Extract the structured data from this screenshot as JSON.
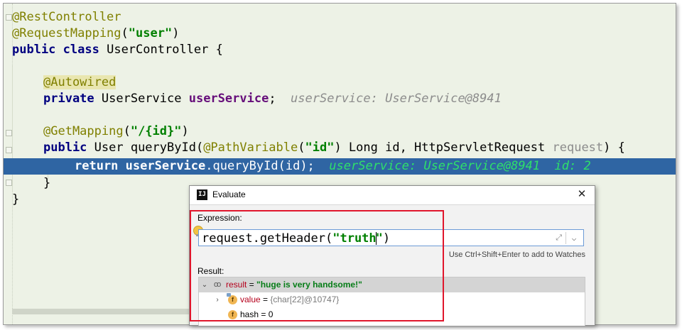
{
  "code": {
    "line1": "@RestController",
    "line2_ann": "@RequestMapping",
    "line2_open": "(",
    "line2_str": "\"user\"",
    "line2_close": ")",
    "line3_kw1": "public",
    "line3_kw2": "class",
    "line3_rest": " UserController {",
    "line5_ann": "@Autowired",
    "line6_kw": "private",
    "line6_type": " UserService ",
    "line6_field": "userService",
    "line6_semi": ";",
    "line6_hint": "userService: UserService@8941",
    "line8_ann": "@GetMapping",
    "line8_open": "(",
    "line8_str": "\"/{id}\"",
    "line8_close": ")",
    "line9_kw": "public",
    "line9_a": " User queryById(",
    "line9_ann": "@PathVariable",
    "line9_b": "(",
    "line9_str": "\"id\"",
    "line9_c": ") Long id, HttpServletRequest ",
    "line9_param": "request",
    "line9_d": ") {",
    "line10_kw": "return",
    "line10_field": "userService",
    "line10_rest": ".queryById(id);",
    "line10_hint": "userService: UserService@8941  id: 2",
    "line11": "}",
    "line12": "}"
  },
  "dialog": {
    "title": "Evaluate",
    "close_glyph": "✕",
    "expression_label": "Expression:",
    "expression_a": "request.getHeader(",
    "expression_str_a": "\"truth",
    "expression_str_b": "\"",
    "expression_b": ")",
    "expand_glyph": "⤢",
    "dropdown_glyph": "⌵",
    "watch_hint": "Use Ctrl+Shift+Enter to add to Watches",
    "result_label": "Result:",
    "tree": {
      "row1_twisty": "⌄",
      "row1_glasses": "oo",
      "row1_name": "result",
      "row1_eq": " = ",
      "row1_value": "\"huge is very handsome!\"",
      "row2_twisty": "›",
      "row2_icon": "f",
      "row2_name": "value",
      "row2_eq": " = ",
      "row2_value": "{char[22]@10747}",
      "row3_icon": "f",
      "row3_name": "hash",
      "row3_eq": " = ",
      "row3_value": "0"
    }
  },
  "colors": {
    "editor_bg": "#edf2e6",
    "execution_line": "#2f65a3",
    "annotation": "#808000",
    "keyword": "#000080",
    "string": "#008000",
    "field": "#660e7a",
    "highlight_box": "#e0162c"
  }
}
